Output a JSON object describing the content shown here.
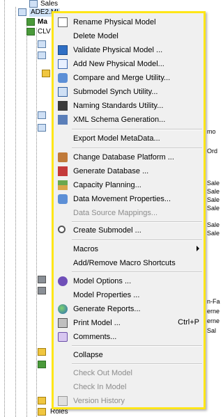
{
  "tree": {
    "top_node": "Sales",
    "root_node": "ADE2.MI",
    "child_1": "Ma",
    "child_2": "CLV",
    "bottom_node": "Roles",
    "right_fragments": [
      "mo",
      "Ord",
      "Sale",
      "Sale",
      "Sale",
      "Sale",
      "Sale",
      "Sale",
      "n-Fa",
      "erne",
      "erne",
      "Sal"
    ]
  },
  "menu": {
    "items": [
      {
        "label": "Rename Physical Model",
        "icon": "rename-icon",
        "enabled": true
      },
      {
        "label": "Delete Model",
        "icon": "delete-icon",
        "enabled": true
      },
      {
        "label": "Validate Physical Model ...",
        "icon": "validate-icon",
        "enabled": true
      },
      {
        "label": "Add New Physical Model...",
        "icon": "add-model-icon",
        "enabled": true
      },
      {
        "label": "Compare and Merge Utility...",
        "icon": "compare-icon",
        "enabled": true
      },
      {
        "label": "Submodel Synch Utility...",
        "icon": "submodel-sync-icon",
        "enabled": true
      },
      {
        "label": "Naming Standards Utility...",
        "icon": "naming-standards-icon",
        "enabled": true
      },
      {
        "label": "XML Schema Generation...",
        "icon": "xml-icon",
        "enabled": true
      },
      {
        "label": "Export Model MetaData...",
        "icon": "",
        "enabled": true
      },
      {
        "label": "Change Database Platform ...",
        "icon": "platform-icon",
        "enabled": true
      },
      {
        "label": "Generate Database ...",
        "icon": "generate-db-icon",
        "enabled": true
      },
      {
        "label": "Capacity Planning...",
        "icon": "capacity-icon",
        "enabled": true
      },
      {
        "label": "Data Movement Properties...",
        "icon": "data-movement-icon",
        "enabled": true
      },
      {
        "label": "Data Source Mappings...",
        "icon": "",
        "enabled": false
      },
      {
        "label": "Create Submodel ...",
        "icon": "create-submodel-icon",
        "enabled": true
      },
      {
        "label": "Macros",
        "icon": "",
        "enabled": true,
        "submenu": true
      },
      {
        "label": "Add/Remove Macro Shortcuts",
        "icon": "",
        "enabled": true
      },
      {
        "label": "Model Options ...",
        "icon": "options-icon",
        "enabled": true
      },
      {
        "label": "Model Properties ...",
        "icon": "",
        "enabled": true
      },
      {
        "label": "Generate Reports...",
        "icon": "reports-icon",
        "enabled": true
      },
      {
        "label": "Print Model ...",
        "icon": "print-icon",
        "enabled": true,
        "shortcut": "Ctrl+P"
      },
      {
        "label": "Comments...",
        "icon": "comments-icon",
        "enabled": true
      },
      {
        "label": "Collapse",
        "icon": "",
        "enabled": true
      },
      {
        "label": "Check Out Model",
        "icon": "",
        "enabled": false
      },
      {
        "label": "Check In Model",
        "icon": "",
        "enabled": false
      },
      {
        "label": "Version History",
        "icon": "version-icon",
        "enabled": false
      }
    ]
  },
  "colors": {
    "highlight_border": "#ffe617",
    "menu_bg": "#f0f0f0",
    "disabled_text": "#8c8c8c"
  }
}
